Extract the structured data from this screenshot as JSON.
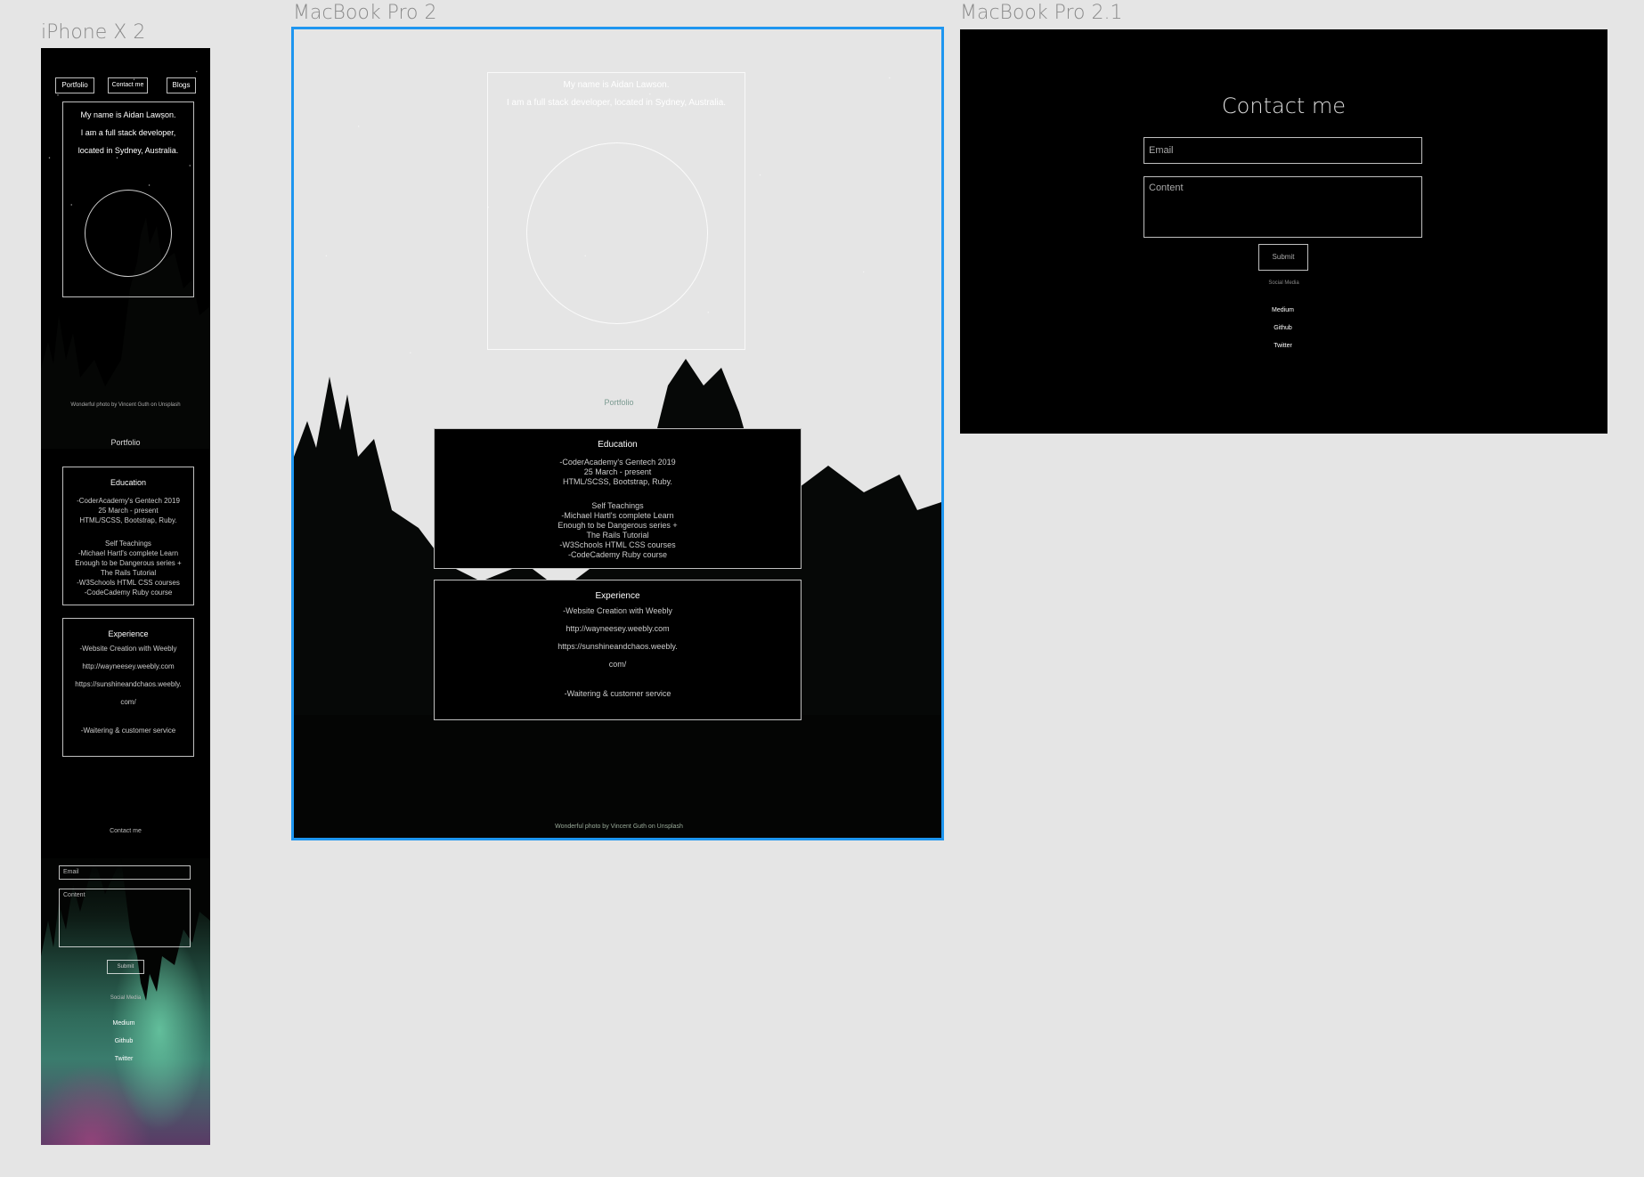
{
  "frames": {
    "iphone": {
      "title": "iPhone X 2"
    },
    "mac": {
      "title": "MacBook Pro 2"
    },
    "mac21": {
      "title": "MacBook Pro 2.1"
    }
  },
  "iphone": {
    "nav": [
      "Portfolio",
      "Contact me",
      "Blogs"
    ],
    "intro": [
      "My name is Aidan Lawson.",
      "I am a full stack developer,",
      "located in Sydney, Australia."
    ],
    "photo_credit": "Wonderful photo by Vincent Guth on Unsplash",
    "portfolio_label": "Portfolio",
    "education": {
      "title": "Education",
      "lines": [
        "-CoderAcademy's Gentech 2019",
        "25 March - present",
        "HTML/SCSS, Bootstrap, Ruby.",
        "",
        "Self Teachings",
        "-Michael Hartl's complete Learn",
        "Enough to be Dangerous series +",
        "The Rails Tutorial",
        "-W3Schools HTML CSS courses",
        "-CodeCademy Ruby course"
      ]
    },
    "experience": {
      "title": "Experience",
      "lines": [
        "-Website Creation with Weebly",
        "http://wayneesey.weebly.com",
        "https://sunshineandchaos.weebly.",
        "com/",
        "",
        "-Waitering & customer service"
      ]
    },
    "contact_label": "Contact me",
    "email_placeholder": "Email",
    "content_placeholder": "Content",
    "submit": "Submit",
    "social_label": "Social Media",
    "social": [
      "Medium",
      "Github",
      "Twitter"
    ]
  },
  "mac": {
    "intro": [
      "My name is Aidan Lawson.",
      "I am a full stack developer, located in Sydney, Australia."
    ],
    "portfolio_label": "Portfolio",
    "education": {
      "title": "Education",
      "lines": [
        "-CoderAcademy's Gentech 2019",
        "25 March - present",
        "HTML/SCSS, Bootstrap, Ruby.",
        "",
        "Self Teachings",
        "-Michael Hartl's complete Learn",
        "Enough to be Dangerous series +",
        "The Rails Tutorial",
        "-W3Schools HTML CSS courses",
        "-CodeCademy Ruby course"
      ]
    },
    "experience": {
      "title": "Experience",
      "lines": [
        "-Website Creation with Weebly",
        "http://wayneesey.weebly.com",
        "https://sunshineandchaos.weebly.",
        "com/",
        "",
        "-Waitering & customer service"
      ]
    },
    "photo_credit": "Wonderful photo by Vincent Guth on Unsplash"
  },
  "contact": {
    "title": "Contact me",
    "email_placeholder": "Email",
    "content_placeholder": "Content",
    "submit": "Submit",
    "social_label": "Social Media",
    "social": [
      "Medium",
      "Github",
      "Twitter"
    ]
  },
  "colors": {
    "canvas": "#e5e5e5",
    "selection": "#1e96f0",
    "frame_title": "#8a8a8a"
  }
}
